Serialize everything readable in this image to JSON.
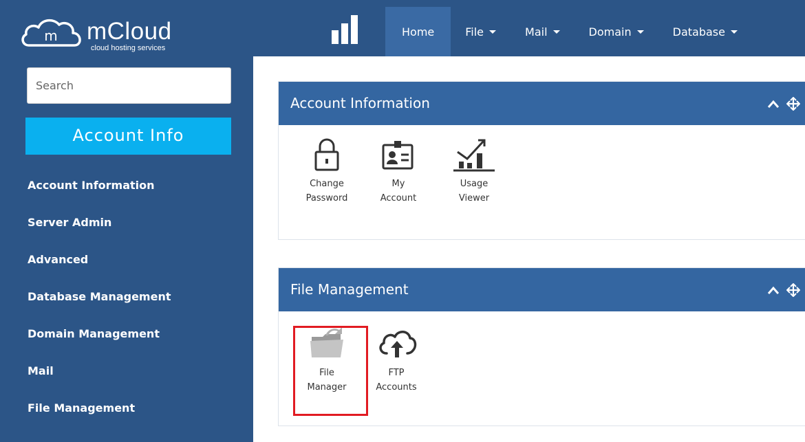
{
  "brand": {
    "initial": "m",
    "name": "mCloud",
    "tagline": "cloud hosting services"
  },
  "topnav": {
    "items": [
      {
        "label": "Home",
        "active": true,
        "dropdown": false
      },
      {
        "label": "File",
        "active": false,
        "dropdown": true
      },
      {
        "label": "Mail",
        "active": false,
        "dropdown": true
      },
      {
        "label": "Domain",
        "active": false,
        "dropdown": true
      },
      {
        "label": "Database",
        "active": false,
        "dropdown": true
      }
    ]
  },
  "sidebar": {
    "search_placeholder": "Search",
    "section_button": "Account Info",
    "links": [
      "Account Information",
      "Server Admin",
      "Advanced",
      "Database Management",
      "Domain Management",
      "Mail",
      "File Management"
    ]
  },
  "panels": {
    "account": {
      "title": "Account Information",
      "tiles": [
        {
          "line1": "Change",
          "line2": "Password",
          "icon": "lock-icon"
        },
        {
          "line1": "My",
          "line2": "Account",
          "icon": "id-card-icon"
        },
        {
          "line1": "Usage",
          "line2": "Viewer",
          "icon": "usage-chart-icon"
        }
      ]
    },
    "files": {
      "title": "File Management",
      "tiles": [
        {
          "line1": "File",
          "line2": "Manager",
          "icon": "folder-icon"
        },
        {
          "line1": "FTP",
          "line2": "Accounts",
          "icon": "cloud-upload-icon"
        }
      ]
    }
  },
  "colors": {
    "header_bg": "#2c5587",
    "nav_active": "#3a6aa4",
    "panel_header": "#3466a1",
    "accent_button": "#0ab0ef",
    "highlight": "#e11b22"
  }
}
